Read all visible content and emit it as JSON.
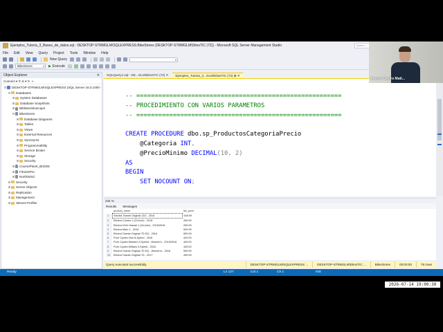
{
  "window": {
    "title": "Ejemplos_Tutoria_3_Bases_de_datos.sql - DESKTOP-STRMGLM\\SQLEXPRESS.BikeStores (DESKTOP-STRMGLM\\DitosTIC (72)) - Microsoft SQL Server Management Studio",
    "quick_launch": "Quick L..."
  },
  "menu": [
    "File",
    "Edit",
    "View",
    "Query",
    "Project",
    "Tools",
    "Window",
    "Help"
  ],
  "toolbar": {
    "new_query": "New Query",
    "database_combo": "BikeStores",
    "execute": "Execute"
  },
  "object_explorer": {
    "title": "Object Explorer",
    "connect": "Connect",
    "items": [
      {
        "label": "DESKTOP-STRMGLM\\SQLEXPRESS (SQL Server 16.0.1000 -",
        "level": 0,
        "toggle": "⊟",
        "kind": "server"
      },
      {
        "label": "Databases",
        "level": 1,
        "toggle": "⊟",
        "kind": "folder"
      },
      {
        "label": "System Databases",
        "level": 2,
        "toggle": "⊞",
        "kind": "folder"
      },
      {
        "label": "Database Snapshots",
        "level": 2,
        "toggle": "⊞",
        "kind": "folder"
      },
      {
        "label": "BibliotecMunicipal",
        "level": 2,
        "toggle": "⊞",
        "kind": "db"
      },
      {
        "label": "BikeStores",
        "level": 2,
        "toggle": "⊟",
        "kind": "db"
      },
      {
        "label": "Database Diagrams",
        "level": 3,
        "toggle": "⊞",
        "kind": "folder"
      },
      {
        "label": "Tables",
        "level": 3,
        "toggle": "⊞",
        "kind": "folder"
      },
      {
        "label": "Views",
        "level": 3,
        "toggle": "⊞",
        "kind": "folder"
      },
      {
        "label": "External Resources",
        "level": 3,
        "toggle": "⊞",
        "kind": "folder"
      },
      {
        "label": "Synonyms",
        "level": 3,
        "toggle": "⊞",
        "kind": "folder"
      },
      {
        "label": "Programmability",
        "level": 3,
        "toggle": "⊞",
        "kind": "folder"
      },
      {
        "label": "Service Broker",
        "level": 3,
        "toggle": "⊞",
        "kind": "folder"
      },
      {
        "label": "Storage",
        "level": 3,
        "toggle": "⊞",
        "kind": "folder"
      },
      {
        "label": "Security",
        "level": 3,
        "toggle": "⊞",
        "kind": "folder"
      },
      {
        "label": "CoursePlanIt_BI2025",
        "level": 2,
        "toggle": "⊞",
        "kind": "db"
      },
      {
        "label": "FitnessPro",
        "level": 2,
        "toggle": "⊞",
        "kind": "db"
      },
      {
        "label": "NorthWind",
        "level": 2,
        "toggle": "⊞",
        "kind": "db"
      },
      {
        "label": "Security",
        "level": 1,
        "toggle": "⊞",
        "kind": "folder"
      },
      {
        "label": "Server Objects",
        "level": 1,
        "toggle": "⊞",
        "kind": "folder"
      },
      {
        "label": "Replication",
        "level": 1,
        "toggle": "⊞",
        "kind": "folder"
      },
      {
        "label": "Management",
        "level": 1,
        "toggle": "⊞",
        "kind": "folder"
      },
      {
        "label": "XEvent Profiler",
        "level": 1,
        "toggle": "⊞",
        "kind": "folder"
      }
    ]
  },
  "tabs": [
    {
      "label": "SQLQuery1.sql - DE...GLM\\DitosTIC (73)",
      "active": false
    },
    {
      "label": "Ejemplos_Tutoria_3...GLM\\DitosTIC (72)",
      "active": true
    }
  ],
  "editor": {
    "lines": [
      {
        "segs": [
          {
            "t": "-- ========================================================",
            "c": "c"
          }
        ]
      },
      {
        "segs": [
          {
            "t": "-- PROCEDIMIENTO CON VARIOS PARAMETROS",
            "c": "c"
          }
        ]
      },
      {
        "segs": [
          {
            "t": "-- ========================================================",
            "c": "c"
          }
        ]
      },
      {
        "segs": [
          {
            "t": "",
            "c": ""
          }
        ]
      },
      {
        "segs": [
          {
            "t": "CREATE PROCEDURE",
            "c": "k"
          },
          {
            "t": " dbo.sp_ProductosCategoriaPrecio",
            "c": ""
          }
        ]
      },
      {
        "segs": [
          {
            "t": "    @Categoria ",
            "c": ""
          },
          {
            "t": "INT",
            "c": "k"
          },
          {
            "t": ",",
            "c": "g"
          }
        ]
      },
      {
        "segs": [
          {
            "t": "    @PrecioMinimo ",
            "c": ""
          },
          {
            "t": "DECIMAL",
            "c": "k"
          },
          {
            "t": "(10",
            "c": "g"
          },
          {
            "t": ", ",
            "c": "g"
          },
          {
            "t": "2)",
            "c": "g"
          }
        ]
      },
      {
        "segs": [
          {
            "t": "AS",
            "c": "k"
          }
        ]
      },
      {
        "segs": [
          {
            "t": "BEGIN",
            "c": "k"
          }
        ]
      },
      {
        "segs": [
          {
            "t": "    SET NOCOUNT ON",
            "c": "k"
          },
          {
            "t": ";",
            "c": "g"
          }
        ]
      }
    ]
  },
  "zoom": "234 %",
  "result_tabs": [
    "Results",
    "Messages"
  ],
  "results": {
    "columns": [
      "",
      "product_name",
      "list_price"
    ],
    "rows": [
      [
        "1",
        "Electra Townie Original 21D - 2016",
        "549.99"
      ],
      [
        "2",
        "Electra Cruiser 1 (24-Inch) - 2016",
        "269.99"
      ],
      [
        "3",
        "Electra Girl's Hawaii 1 (16-inch) - 2015/2016",
        "269.99"
      ],
      [
        "4",
        "Electra Moto 1 - 2016",
        "529.99"
      ],
      [
        "5",
        "Electra Townie Original 7D EQ - 2016",
        "599.99"
      ],
      [
        "6",
        "Pure Cycles Vine 8-Speed - 2016",
        "429.00"
      ],
      [
        "7",
        "Pure Cycles Western 3-Speed - Women's - 2015/2016",
        "449.00"
      ],
      [
        "8",
        "Pure Cycles William 3-Speed - 2016",
        "449.00"
      ],
      [
        "9",
        "Electra Townie Original 7D EQ - Women's - 2016",
        "599.99"
      ],
      [
        "10",
        "Electra Townie Original 7D - 2017",
        "499.99"
      ]
    ]
  },
  "query_status": {
    "message": "Query executed successfully.",
    "server": "DESKTOP-STRMGLM\\SQLEXPRESS ...",
    "user": "DESKTOP-STRMGLM\\DitosTIC ...",
    "db": "BikeStores",
    "time": "00:00:00",
    "rows": "78 rows"
  },
  "status_bar": {
    "ready": "Ready",
    "ln": "Ln 127",
    "col": "Col 1",
    "ch": "Ch 1",
    "ins": "INS"
  },
  "webcam": {
    "name": "Alonso Castro Matt..."
  },
  "clock": "2026-07-14 19:00:30"
}
